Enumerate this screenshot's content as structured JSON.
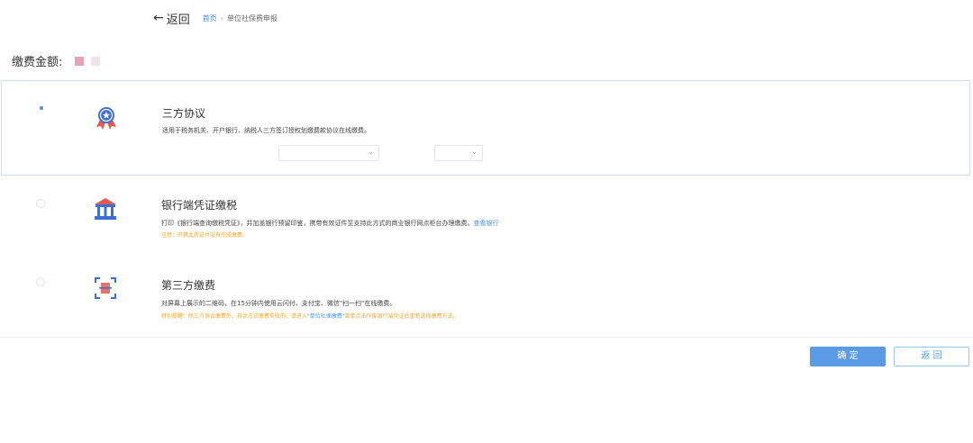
{
  "header": {
    "back_arrow": "←",
    "back_label": "返回",
    "breadcrumb": [
      {
        "label": "首页"
      },
      {
        "label": "单位社保费申报"
      }
    ],
    "separator": "›"
  },
  "amount": {
    "label": "缴费金额:"
  },
  "options": [
    {
      "title": "三方协议",
      "icon": "award-badge-icon",
      "selected": true,
      "desc": "适用于税务机关、开户银行、纳税人三方签订授权划缴费款协议在线缴费。"
    },
    {
      "title": "银行端凭证缴税",
      "icon": "bank-icon",
      "selected": false,
      "desc": "打印《银行端查询缴税凭证》，并加盖银行预留印鉴，携带有效证件至支持此方式的商业银行网点柜台办理缴费。",
      "link": "查看银行",
      "note": "注意：开具此凭证并没有完成缴费。"
    },
    {
      "title": "第三方缴费",
      "icon": "qr-scan-icon",
      "selected": false,
      "desc": "对屏幕上展示的二维码，在15分钟内使用云闪付、支付宝、微信\"扫一扫\"在线缴费。",
      "note_prefix": "特别提醒：除三方协议缴费外，其余方式缴费失败的，请进入",
      "note_link": "\"单位社保缴费\"",
      "note_suffix": "菜单点击作废银行端凭证后重新选择缴费方式。"
    }
  ],
  "actions": {
    "confirm_label": "确 定",
    "return_label": "返 回"
  },
  "colors": {
    "accent": "#4a90e2",
    "warning": "#f5a623",
    "border_selected": "#cfe0f5"
  }
}
